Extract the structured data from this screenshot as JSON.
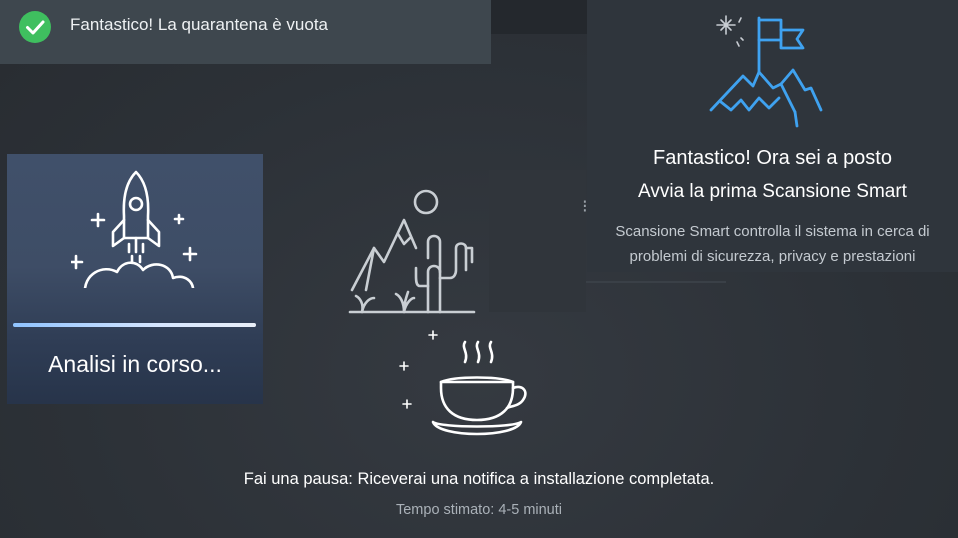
{
  "toast": {
    "message": "Fantastico! La quarantena è vuota",
    "icon": "check-circle-icon",
    "status_color": "#3fbf5f"
  },
  "analysis": {
    "label": "Analisi in corso...",
    "icon": "rocket-icon",
    "progress": 1.0
  },
  "success": {
    "icon": "mountain-flag-icon",
    "title": "Fantastico! Ora sei a posto",
    "subtitle": "Avvia la prima Scansione Smart",
    "description_line1": "Scansione Smart controlla il sistema in cerca di",
    "description_line2": "problemi di sicurezza, privacy e prestazioni",
    "accent_color": "#3fa2f0"
  },
  "illustrations": {
    "desert": "desert-icon",
    "cup": "coffee-cup-icon"
  },
  "footer": {
    "message": "Fai una pausa: Riceverai una notifica a installazione completata.",
    "estimate": "Tempo stimato: 4-5 minuti"
  }
}
